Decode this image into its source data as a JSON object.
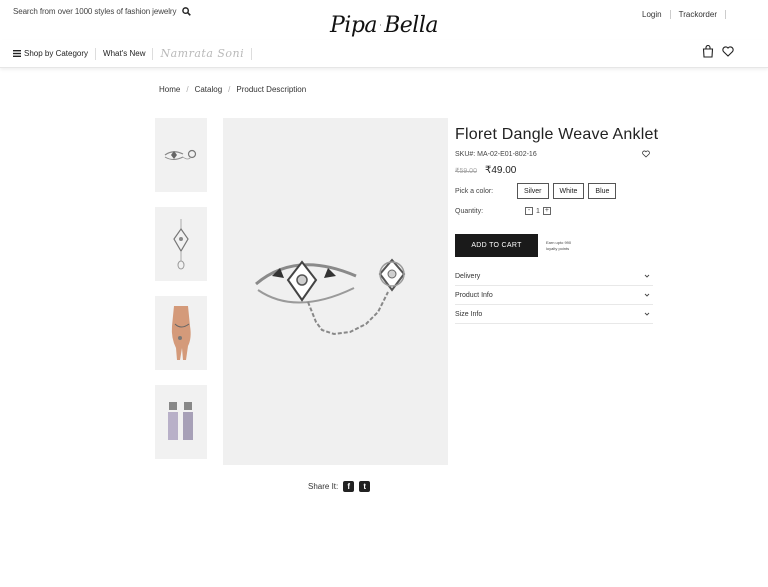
{
  "header": {
    "search_placeholder": "Search from over 1000 styles of fashion jewelry",
    "logo_left": "Pipa",
    "logo_right": "Bella",
    "links": [
      "Login",
      "Trackorder"
    ]
  },
  "nav": {
    "shop_by_category": "Shop by Category",
    "whats_new": "What's New",
    "signature": "Namrata Soni"
  },
  "breadcrumb": [
    "Home",
    "Catalog",
    "Product Description"
  ],
  "product": {
    "title": "Floret Dangle Weave Anklet",
    "sku": "SKU#: MA-02-E01-802-16",
    "old_price": "₹59.00",
    "price": "₹49.00",
    "color_label": "Pick a color:",
    "colors": [
      "Silver",
      "White",
      "Blue"
    ],
    "quantity_label": "Quantity:",
    "quantity": "1",
    "add_to_cart": "ADD TO CART",
    "earn_text": "Earn upto 990 loyalty points",
    "accordion": [
      "Delivery",
      "Product Info",
      "Size Info"
    ]
  },
  "share": {
    "label": "Share It:"
  },
  "colors": {
    "accent": "#1a1a1a",
    "image_bg": "#f0f0f0"
  }
}
